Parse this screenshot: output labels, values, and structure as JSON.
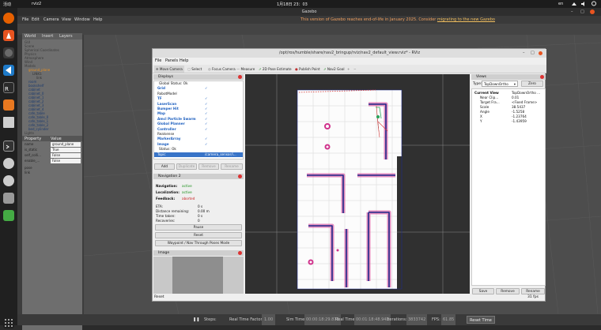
{
  "topbar": {
    "activities": "活动",
    "app": "rviz2",
    "clock": "1月18日  23：03",
    "lang": "en"
  },
  "gazebo": {
    "title": "Gazebo",
    "menu": [
      "File",
      "Edit",
      "Camera",
      "View",
      "Window",
      "Help"
    ],
    "eol_text": "This version of Gazebo reaches end-of-life in January 2025. Consider ",
    "eol_link": "migrating to the new Gazebo",
    "tabs": [
      "World",
      "Insert",
      "Layers"
    ],
    "tree": [
      {
        "label": "GUI",
        "indent": 0,
        "color": "#3a3a3a"
      },
      {
        "label": "Scene",
        "indent": 0,
        "color": "#3a3a3a"
      },
      {
        "label": "Spherical Coordinates",
        "indent": 0,
        "color": "#3a3a3a"
      },
      {
        "label": "Physics",
        "indent": 0,
        "color": "#3a3a3a"
      },
      {
        "label": "Atmosphere",
        "indent": 0,
        "color": "#3a3a3a"
      },
      {
        "label": "Wind",
        "indent": 0,
        "color": "#3a3a3a"
      },
      {
        "label": "Models",
        "indent": 0,
        "color": "#3a3a3a"
      },
      {
        "label": "ground_plane",
        "indent": 1,
        "color": "#e89020"
      },
      {
        "label": "LINKS",
        "indent": 2,
        "color": "#333"
      },
      {
        "label": "link",
        "indent": 3,
        "color": "#333"
      },
      {
        "label": "room",
        "indent": 1,
        "color": "#1a3a6e"
      },
      {
        "label": "bookshelf",
        "indent": 1,
        "color": "#1a3a6e"
      },
      {
        "label": "cabinet",
        "indent": 1,
        "color": "#1a3a6e"
      },
      {
        "label": "cabinet_0",
        "indent": 1,
        "color": "#1a3a6e"
      },
      {
        "label": "cabinet_1",
        "indent": 1,
        "color": "#1a3a6e"
      },
      {
        "label": "cabinet_2",
        "indent": 1,
        "color": "#1a3a6e"
      },
      {
        "label": "cabinet_3",
        "indent": 1,
        "color": "#1a3a6e"
      },
      {
        "label": "cabinet_4",
        "indent": 1,
        "color": "#1a3a6e"
      },
      {
        "label": "cafe_table",
        "indent": 1,
        "color": "#1a3a6e"
      },
      {
        "label": "cafe_table_0",
        "indent": 1,
        "color": "#1a3a6e"
      },
      {
        "label": "cafe_table_1",
        "indent": 1,
        "color": "#1a3a6e"
      },
      {
        "label": "cafe_table_2",
        "indent": 1,
        "color": "#1a3a6e"
      },
      {
        "label": "bed_cylinder",
        "indent": 1,
        "color": "#1a3a6e"
      },
      {
        "label": "Lights",
        "indent": 0,
        "color": "#3a3a3a"
      }
    ],
    "prop_headers": [
      "Property",
      "Value"
    ],
    "props": [
      {
        "name": "name",
        "value": "ground_plane"
      },
      {
        "name": "is_static",
        "value": "True"
      },
      {
        "name": "self_colli...",
        "value": "False"
      },
      {
        "name": "enable_...",
        "value": "False"
      }
    ],
    "prop_groups": [
      "pose",
      "link"
    ],
    "bottom": {
      "steps_label": "Steps:",
      "rtf_label": "Real Time Factor:",
      "rtf_value": "1.00",
      "sim_label": "Sim Time:",
      "sim_value": "00:00:18:29.873",
      "real_label": "Real Time:",
      "real_value": "00:01:18:48.943",
      "iter_label": "Iterations:",
      "iter_value": "3833742",
      "fps_label": "FPS:",
      "fps_value": "61.85",
      "reset": "Reset Time"
    }
  },
  "rviz": {
    "title": "/opt/ros/humble/share/nav2_bringup/rviz/nav2_default_view.rviz* - RViz",
    "menu": [
      "File",
      "Panels",
      "Help"
    ],
    "tools": [
      "Move Camera",
      "Select",
      "Focus Camera",
      "Measure",
      "2D Pose Estimate",
      "Publish Point",
      "Nav2 Goal"
    ],
    "displays_title": "Displays",
    "displays": [
      {
        "label": "Global Status: Ok",
        "check": "",
        "color": "#111"
      },
      {
        "label": "Grid",
        "check": "✓",
        "color": "#1d5fbf"
      },
      {
        "label": "RobotModel",
        "check": "",
        "color": "#111"
      },
      {
        "label": "TF",
        "check": "✓",
        "color": "#1d5fbf"
      },
      {
        "label": "LaserScan",
        "check": "✓",
        "color": "#1d5fbf"
      },
      {
        "label": "Bumper Hit",
        "check": "✓",
        "color": "#1d5fbf"
      },
      {
        "label": "Map",
        "check": "✓",
        "color": "#1d5fbf"
      },
      {
        "label": "Amcl Particle Swarm",
        "check": "✓",
        "color": "#1d5fbf"
      },
      {
        "label": "Global Planner",
        "check": "✓",
        "color": "#1d5fbf"
      },
      {
        "label": "Controller",
        "check": "✓",
        "color": "#1d5fbf"
      },
      {
        "label": "Realsense",
        "check": "",
        "color": "#111"
      },
      {
        "label": "MarkerArray",
        "check": "✓",
        "color": "#1d5fbf"
      },
      {
        "label": "Image",
        "check": "✓",
        "color": "#1d5fbf"
      },
      {
        "label": "Status: Ok",
        "check": "",
        "color": "#111"
      },
      {
        "label": "Topic",
        "check": "",
        "color": "#fff"
      }
    ],
    "topic_value": "/camera_sensor/i...",
    "display_buttons": [
      "Add",
      "Duplicate",
      "Remove",
      "Rename"
    ],
    "nav_title": "Navigation 2",
    "nav": [
      {
        "k": "Navigation:",
        "v": "active",
        "vc": "#1a8f1a"
      },
      {
        "k": "Localization:",
        "v": "active",
        "vc": "#1a8f1a"
      },
      {
        "k": "Feedback:",
        "v": "aborted",
        "vc": "#c81e1e"
      }
    ],
    "nav_stats": [
      {
        "k": "ETA:",
        "v": "0 s"
      },
      {
        "k": "Distance remaining:",
        "v": "0.00 m"
      },
      {
        "k": "Time taken:",
        "v": "0 s"
      },
      {
        "k": "Recoveries:",
        "v": "0"
      }
    ],
    "nav_buttons": [
      "Pause",
      "Reset",
      "Waypoint / Nav Through Poses Mode"
    ],
    "image_title": "Image",
    "reset": "Reset",
    "views_title": "Views",
    "type_label": "Type:",
    "type_value": "TopDownOrtho",
    "zero": "Zero",
    "views": [
      {
        "k": "Current View",
        "v": "TopDownOrtho ...",
        "bold": true
      },
      {
        "k": "Near Clip...",
        "v": "0.01"
      },
      {
        "k": "Target Fra...",
        "v": "<Fixed Frame>"
      },
      {
        "k": "Scale",
        "v": "38.5437"
      },
      {
        "k": "Angle",
        "v": "-1.5258"
      },
      {
        "k": "X",
        "v": "-1.23764"
      },
      {
        "k": "Y",
        "v": "-1.43959"
      }
    ],
    "views_buttons": [
      "Save",
      "Remove",
      "Rename"
    ],
    "fps": "31 fps"
  },
  "colors": {
    "accent_orange": "#e95420",
    "rviz_select": "#3874c8",
    "map_wall": "#1e2a8a",
    "costmap": "#d0328c",
    "path": "#d63a3a"
  }
}
